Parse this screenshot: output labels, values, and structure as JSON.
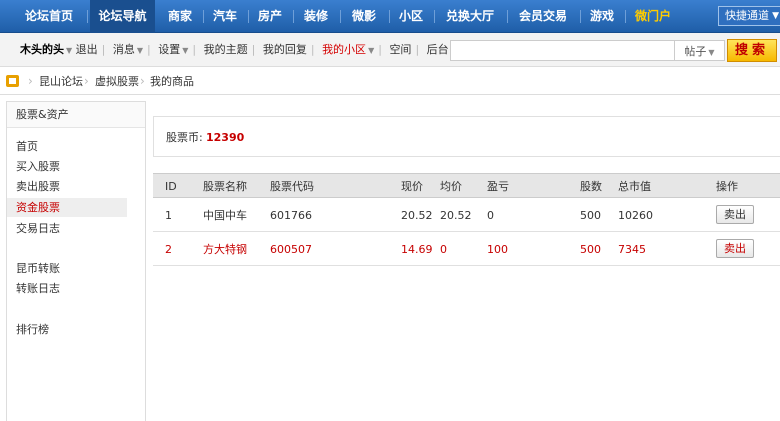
{
  "topnav": {
    "items": [
      {
        "label": "论坛首页"
      },
      {
        "label": "论坛导航"
      },
      {
        "label": "商家"
      },
      {
        "label": "汽车"
      },
      {
        "label": "房产"
      },
      {
        "label": "装修"
      },
      {
        "label": "微影"
      },
      {
        "label": "小区"
      },
      {
        "label": "兑换大厅"
      },
      {
        "label": "会员交易"
      },
      {
        "label": "游戏"
      },
      {
        "label": "微门户"
      }
    ],
    "quick_label": "快捷通道"
  },
  "userbar": {
    "username": "木头的头",
    "logout": "退出",
    "messages": "消息",
    "settings": "设置",
    "my_threads": "我的主题",
    "my_replies": "我的回复",
    "my_community": "我的小区",
    "space": "空间",
    "admin": "后台",
    "search_placeholder": "",
    "search_type": "帖子",
    "search_button": "搜索"
  },
  "breadcrumb": {
    "items": [
      "昆山论坛",
      "虚拟股票",
      "我的商品"
    ]
  },
  "sidebar": {
    "title": "股票&资产",
    "links": [
      "首页",
      "买入股票",
      "卖出股票",
      "资金股票",
      "交易日志",
      "昆币转账",
      "转账日志",
      "排行榜"
    ]
  },
  "balance": {
    "label": "股票币:",
    "value": "12390"
  },
  "table": {
    "headers": [
      "ID",
      "股票名称",
      "股票代码",
      "现价",
      "均价",
      "盈亏",
      "股数",
      "总市值",
      "操作"
    ],
    "rows": [
      {
        "id": "1",
        "name": "中国中车",
        "code": "601766",
        "price": "20.52",
        "avg": "20.52",
        "pl": "0",
        "shares": "500",
        "value": "10260",
        "action": "卖出"
      },
      {
        "id": "2",
        "name": "方大特钢",
        "code": "600507",
        "price": "14.69",
        "avg": "0",
        "pl": "100",
        "shares": "500",
        "value": "7345",
        "action": "卖出"
      }
    ]
  },
  "colors": {
    "nav_blue": "#2b6cb8",
    "accent_red": "#c60000",
    "search_yellow": "#f7b900"
  }
}
